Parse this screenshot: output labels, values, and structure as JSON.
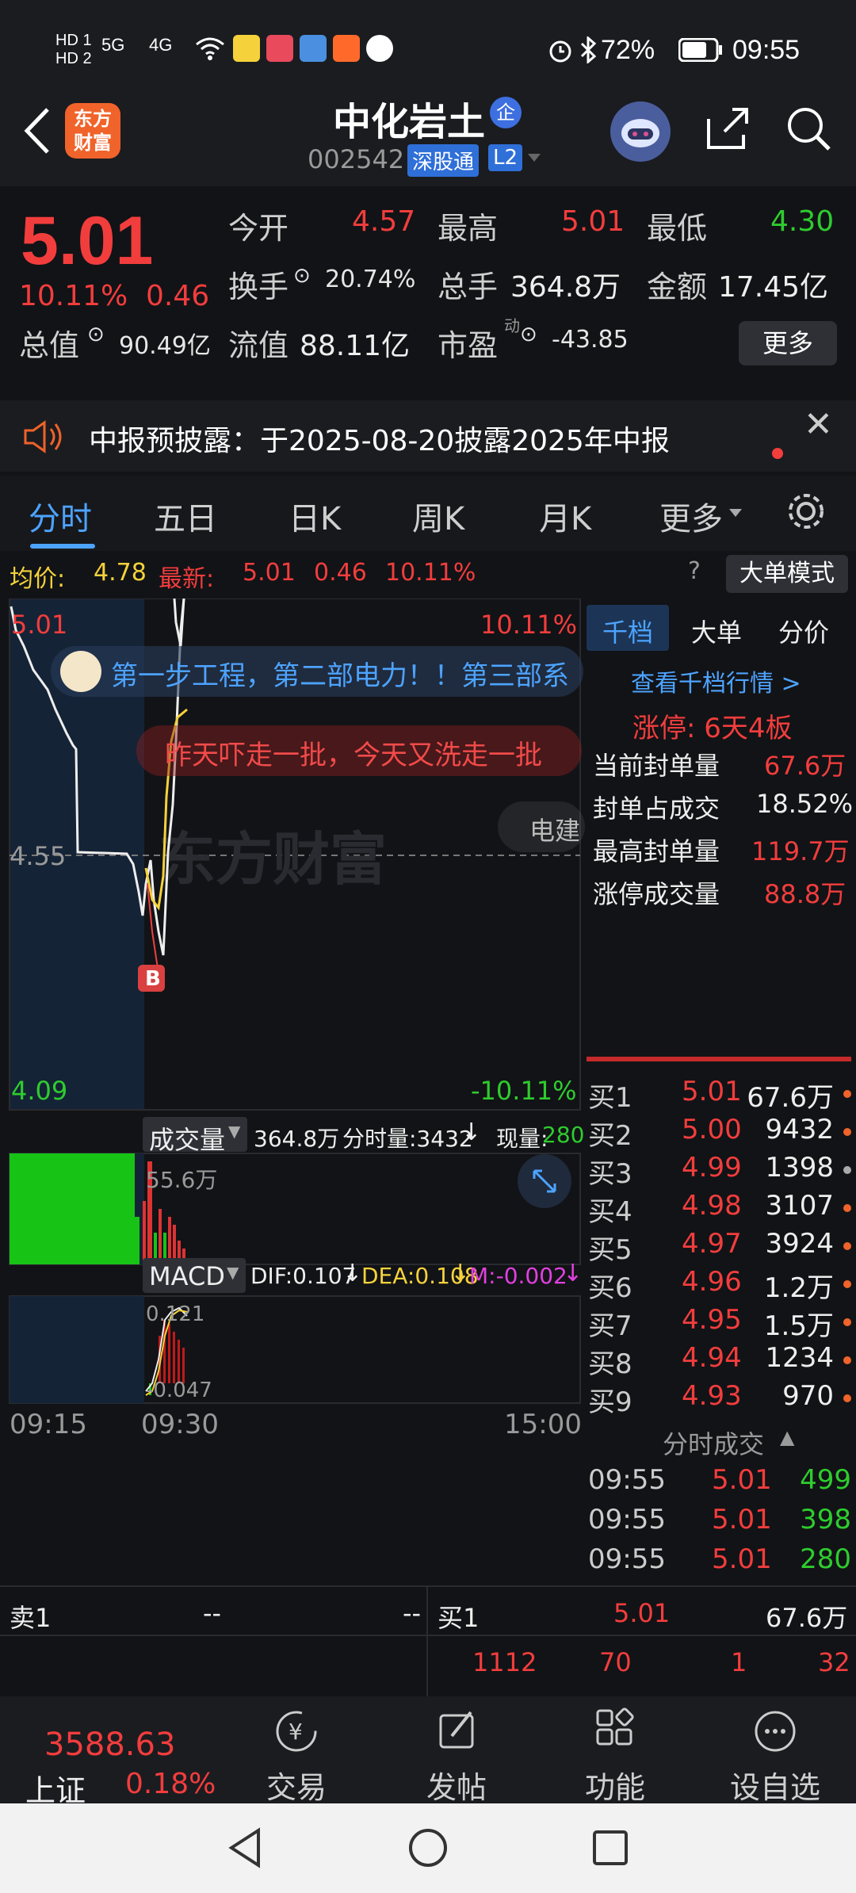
{
  "status_bar": {
    "time": "09:55",
    "battery": "72%",
    "network": "5G",
    "network2": "4G"
  },
  "header": {
    "logo_text": "东方财富",
    "stock_name": "中化岩土",
    "badge": "企",
    "stock_code": "002542",
    "tag_connect": "深股通",
    "tag_level": "L2"
  },
  "quote": {
    "price": "5.01",
    "change_pct": "10.11%",
    "change_abs": "0.46",
    "open_label": "今开",
    "open_value": "4.57",
    "high_label": "最高",
    "high_value": "5.01",
    "low_label": "最低",
    "low_value": "4.30",
    "turnover_label": "换手",
    "turnover_value": "20.74%",
    "volume_label": "总手",
    "volume_value": "364.8万",
    "amount_label": "金额",
    "amount_value": "17.45亿",
    "mktcap_label": "总值",
    "mktcap_value": "90.49亿",
    "float_label": "流值",
    "float_value": "88.11亿",
    "pe_label": "市盈",
    "pe_sup": "动",
    "pe_value": "-43.85",
    "more": "更多"
  },
  "notice": {
    "text": "中报预披露：于2025-08-20披露2025年中报"
  },
  "tabs": [
    {
      "label": "分时"
    },
    {
      "label": "五日"
    },
    {
      "label": "日K"
    },
    {
      "label": "周K"
    },
    {
      "label": "月K"
    },
    {
      "label": "更多"
    }
  ],
  "infoline": {
    "avg_label": "均价:",
    "avg_value": "4.78",
    "latest_label": "最新:",
    "latest_value": "5.01",
    "latest_chg": "0.46",
    "latest_pct": "10.11%",
    "mode_button": "大单模式"
  },
  "chart": {
    "price_top": "5.01",
    "price_mid": "4.55",
    "price_bottom": "4.09",
    "pct_top": "10.11%",
    "pct_bottom": "-10.11%",
    "comment1": "第一步工程，第二部电力！！第三部系",
    "comment2": "昨天吓走一批，今天又洗走一批",
    "comment3": "电建",
    "watermark": "东方财富",
    "buy_marker": "B",
    "volume_label": "成交量",
    "volume_total": "364.8万",
    "volume_split": "分时量:3432",
    "volume_now_label": "现量:",
    "volume_now": "280",
    "volume_max": "55.6万",
    "macd_label": "MACD",
    "dif": "DIF:0.107",
    "dea": "DEA:0.108",
    "m": "M:-0.002",
    "macd_top": "0.121",
    "macd_bottom": "-0.047",
    "time_start": "09:15",
    "time_mid": "09:30",
    "time_end": "15:00"
  },
  "order_panel": {
    "tabs": [
      "千档",
      "大单",
      "分价"
    ],
    "link": "查看千档行情 >",
    "limit_label": "涨停: 6天4板",
    "stats": [
      {
        "label": "当前封单量",
        "value": "67.6万"
      },
      {
        "label": "封单占成交",
        "value": "18.52%"
      },
      {
        "label": "最高封单量",
        "value": "119.7万"
      },
      {
        "label": "涨停成交量",
        "value": "88.8万"
      }
    ],
    "bids": [
      {
        "label": "买1",
        "price": "5.01",
        "qty": "67.6万"
      },
      {
        "label": "买2",
        "price": "5.00",
        "qty": "9432"
      },
      {
        "label": "买3",
        "price": "4.99",
        "qty": "1398"
      },
      {
        "label": "买4",
        "price": "4.98",
        "qty": "3107"
      },
      {
        "label": "买5",
        "price": "4.97",
        "qty": "3924"
      },
      {
        "label": "买6",
        "price": "4.96",
        "qty": "1.2万"
      },
      {
        "label": "买7",
        "price": "4.95",
        "qty": "1.5万"
      },
      {
        "label": "买8",
        "price": "4.94",
        "qty": "1234"
      },
      {
        "label": "买9",
        "price": "4.93",
        "qty": "970"
      }
    ],
    "trades_title": "分时成交",
    "trades": [
      {
        "time": "09:55",
        "price": "5.01",
        "qty": "499"
      },
      {
        "time": "09:55",
        "price": "5.01",
        "qty": "398"
      },
      {
        "time": "09:55",
        "price": "5.01",
        "qty": "280"
      }
    ]
  },
  "depth": {
    "sell_label": "卖1",
    "sell_price": "--",
    "sell_qty": "--",
    "buy_label": "买1",
    "buy_price": "5.01",
    "buy_qty": "67.6万",
    "queue": [
      "1112",
      "70",
      "1",
      "32"
    ]
  },
  "bottom_nav": {
    "index_value": "3588.63",
    "index_name": "上证",
    "index_pct": "0.18%",
    "items": [
      "交易",
      "发帖",
      "功能",
      "设自选"
    ]
  },
  "chart_data": {
    "type": "line",
    "title": "",
    "x": [
      "09:15",
      "09:30",
      "15:00"
    ],
    "ylim": [
      4.09,
      5.01
    ],
    "series": [
      {
        "name": "price",
        "values": [
          5.0,
          4.95,
          4.9,
          4.85,
          4.75,
          4.55,
          4.55,
          4.5,
          4.45,
          4.4,
          4.5,
          4.8,
          5.01
        ]
      },
      {
        "name": "均价",
        "values": [
          4.45,
          4.5,
          4.62,
          4.7,
          4.75,
          4.78
        ]
      }
    ],
    "grid": true
  }
}
